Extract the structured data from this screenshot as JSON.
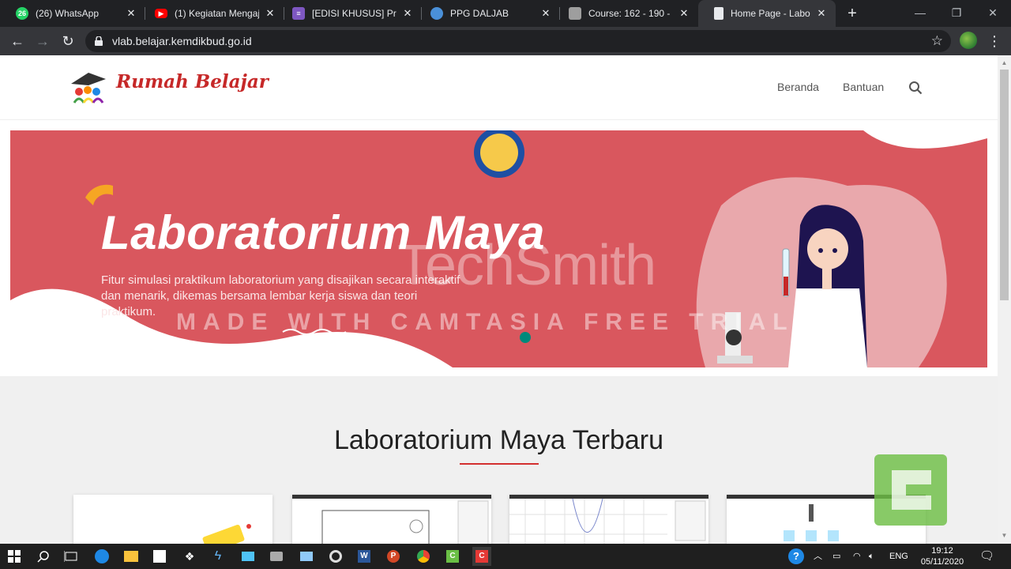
{
  "browser": {
    "tabs": [
      {
        "title": "(26) WhatsApp",
        "favicon": "whatsapp-icon",
        "badge": "26",
        "color": "#25d366"
      },
      {
        "title": "(1) Kegiatan Mengaja",
        "favicon": "youtube-icon",
        "color": "#ff0000"
      },
      {
        "title": "[EDISI KHUSUS] Pres",
        "favicon": "list-icon",
        "color": "#7e57c2"
      },
      {
        "title": "PPG DALJAB",
        "favicon": "site-icon",
        "color": "#4a90d9"
      },
      {
        "title": "Course: 162 - 190 - ",
        "favicon": "moodle-icon",
        "color": "#9e9e9e"
      },
      {
        "title": "Home Page - Labora",
        "favicon": "page-icon",
        "color": "#e8eaed"
      }
    ],
    "url": "vlab.belajar.kemdikbud.go.id"
  },
  "site": {
    "logo_text": "Rumah Belajar",
    "nav": [
      "Beranda",
      "Bantuan"
    ],
    "banner": {
      "title": "Laboratorium Maya",
      "description": "Fitur simulasi praktikum laboratorium yang disajikan secara interaktif dan menarik, dikemas bersama lembar kerja siswa dan teori praktikum."
    },
    "watermark": {
      "brand": "TechSmith",
      "trial": "MADE WITH CAMTASIA FREE TRIAL"
    },
    "section_title": "Laboratorium Maya Terbaru"
  },
  "taskbar": {
    "language": "ENG",
    "time": "19:12",
    "date": "05/11/2020"
  },
  "colors": {
    "banner": "#d9575e",
    "accent": "#d32f2f",
    "chrome_dark": "#202124"
  }
}
